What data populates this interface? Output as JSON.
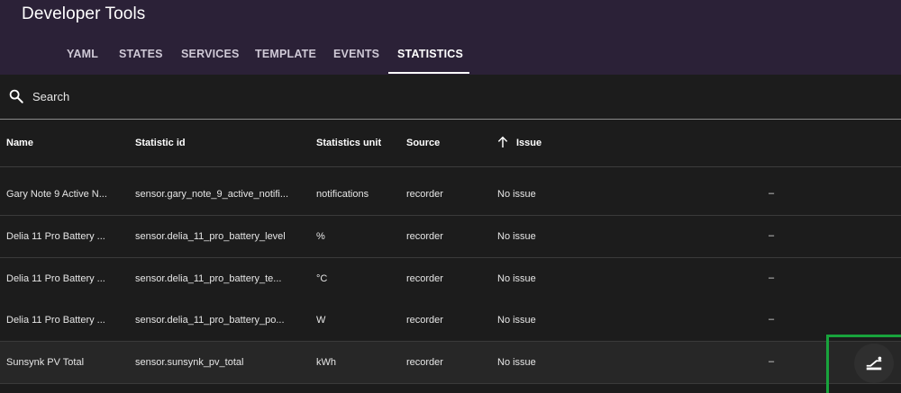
{
  "app": {
    "title": "Developer Tools"
  },
  "tabs": [
    {
      "label": "YAML"
    },
    {
      "label": "STATES"
    },
    {
      "label": "SERVICES"
    },
    {
      "label": "TEMPLATE"
    },
    {
      "label": "EVENTS"
    },
    {
      "label": "STATISTICS",
      "active": true
    }
  ],
  "search": {
    "placeholder": "Search"
  },
  "columns": {
    "name": "Name",
    "statistic_id": "Statistic id",
    "unit": "Statistics unit",
    "source": "Source",
    "issue": "Issue"
  },
  "rows": [
    {
      "name": "Gary Note 9 Active N...",
      "statistic_id": "sensor.gary_note_9_active_notifi...",
      "unit": "notifications",
      "source": "recorder",
      "issue": "No issue",
      "action": "–"
    },
    {
      "name": "Delia 11 Pro Battery ...",
      "statistic_id": "sensor.delia_11_pro_battery_level",
      "unit": "%",
      "source": "recorder",
      "issue": "No issue",
      "action": "–"
    },
    {
      "name": "Delia 11 Pro Battery ...",
      "statistic_id": "sensor.delia_11_pro_battery_te...",
      "unit": "°C",
      "source": "recorder",
      "issue": "No issue",
      "action": "–"
    },
    {
      "name": "Delia 11 Pro Battery ...",
      "statistic_id": "sensor.delia_11_pro_battery_po...",
      "unit": "W",
      "source": "recorder",
      "issue": "No issue",
      "action": "–"
    },
    {
      "name": "Sunsynk PV Total",
      "statistic_id": "sensor.sunsynk_pv_total",
      "unit": "kWh",
      "source": "recorder",
      "issue": "No issue",
      "action": "–"
    }
  ],
  "icons": {
    "search": "search-icon",
    "sort": "arrow-up-icon",
    "fab": "adjust-sum-icon"
  },
  "colors": {
    "header": "#2b2137",
    "background": "#1c1c1c",
    "highlight_box": "#18a33c"
  }
}
